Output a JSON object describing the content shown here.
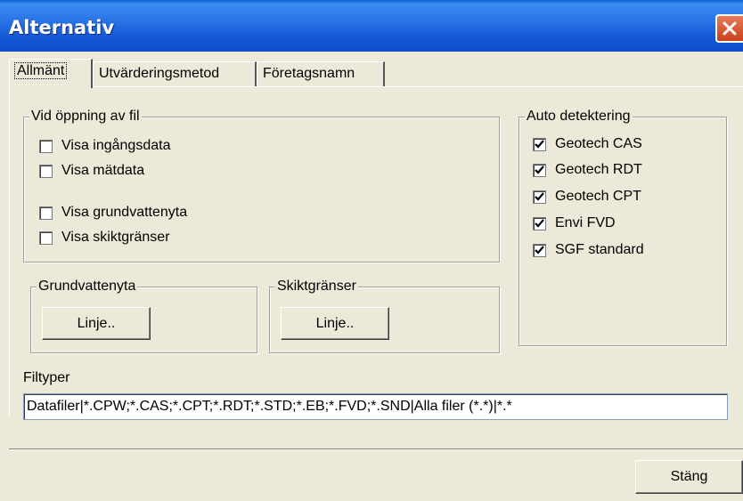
{
  "window": {
    "title": "Alternativ"
  },
  "tabs": [
    {
      "label": "Allmänt",
      "active": true
    },
    {
      "label": "Utvärderingsmetod",
      "active": false
    },
    {
      "label": "Företagsnamn",
      "active": false
    }
  ],
  "open_group": {
    "legend": "Vid öppning av fil",
    "items": [
      {
        "label": "Visa ingångsdata",
        "checked": false
      },
      {
        "label": "Visa mätdata",
        "checked": false
      },
      {
        "label": "Visa grundvattenyta",
        "checked": false
      },
      {
        "label": "Visa skiktgränser",
        "checked": false
      }
    ]
  },
  "auto_group": {
    "legend": "Auto detektering",
    "items": [
      {
        "label": "Geotech CAS",
        "checked": true
      },
      {
        "label": "Geotech RDT",
        "checked": true
      },
      {
        "label": "Geotech CPT",
        "checked": true
      },
      {
        "label": "Envi FVD",
        "checked": true
      },
      {
        "label": "SGF standard",
        "checked": true
      }
    ]
  },
  "groundwater_group": {
    "legend": "Grundvattenyta",
    "button_label": "Linje.."
  },
  "layer_group": {
    "legend": "Skiktgränser",
    "button_label": "Linje.."
  },
  "filetypes": {
    "label": "Filtyper",
    "value": "Datafiler|*.CPW;*.CAS;*.CPT;*.RDT;*.STD;*.EB;*.FVD;*.SND|Alla filer (*.*)|*.*"
  },
  "footer": {
    "close_label": "Stäng"
  },
  "icons": {
    "close": "close-icon",
    "check": "checkmark-icon"
  }
}
